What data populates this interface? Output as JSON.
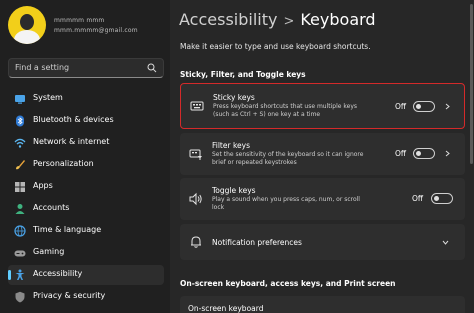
{
  "profile": {
    "name": "mmmmm mmm",
    "email": "mmm.mmmm@gmail.com"
  },
  "search": {
    "placeholder": "Find a setting"
  },
  "sidebar": {
    "items": [
      {
        "label": "System",
        "icon": "monitor-icon"
      },
      {
        "label": "Bluetooth & devices",
        "icon": "bluetooth-icon"
      },
      {
        "label": "Network & internet",
        "icon": "wifi-icon"
      },
      {
        "label": "Personalization",
        "icon": "brush-icon"
      },
      {
        "label": "Apps",
        "icon": "apps-icon"
      },
      {
        "label": "Accounts",
        "icon": "person-icon"
      },
      {
        "label": "Time & language",
        "icon": "globe-icon"
      },
      {
        "label": "Gaming",
        "icon": "gamepad-icon"
      },
      {
        "label": "Accessibility",
        "icon": "accessibility-icon",
        "active": true
      },
      {
        "label": "Privacy & security",
        "icon": "shield-icon"
      }
    ]
  },
  "header": {
    "parent": "Accessibility",
    "separator": ">",
    "current": "Keyboard"
  },
  "subtitle": "Make it easier to type and use keyboard shortcuts.",
  "sections": {
    "sticky_filter_toggle": "Sticky, Filter, and Toggle keys",
    "onscreen": "On-screen keyboard, access keys, and Print screen"
  },
  "cards": {
    "sticky": {
      "title": "Sticky keys",
      "desc": "Press keyboard shortcuts that use multiple keys (such as Ctrl + S) one key at a time",
      "state": "Off",
      "icon": "sticky-keys-icon"
    },
    "filter": {
      "title": "Filter keys",
      "desc": "Set the sensitivity of the keyboard so it can ignore brief or repeated keystrokes",
      "state": "Off",
      "icon": "filter-keys-icon"
    },
    "toggle": {
      "title": "Toggle keys",
      "desc": "Play a sound when you press caps, num, or scroll lock",
      "state": "Off",
      "icon": "speaker-icon"
    },
    "notification": {
      "title": "Notification preferences",
      "icon": "bell-icon"
    },
    "onscreen": {
      "title": "On-screen keyboard"
    }
  },
  "colors": {
    "accent": "#60cdff",
    "highlight_border": "#d42a2a",
    "avatar_bg": "#f2cf1a"
  }
}
